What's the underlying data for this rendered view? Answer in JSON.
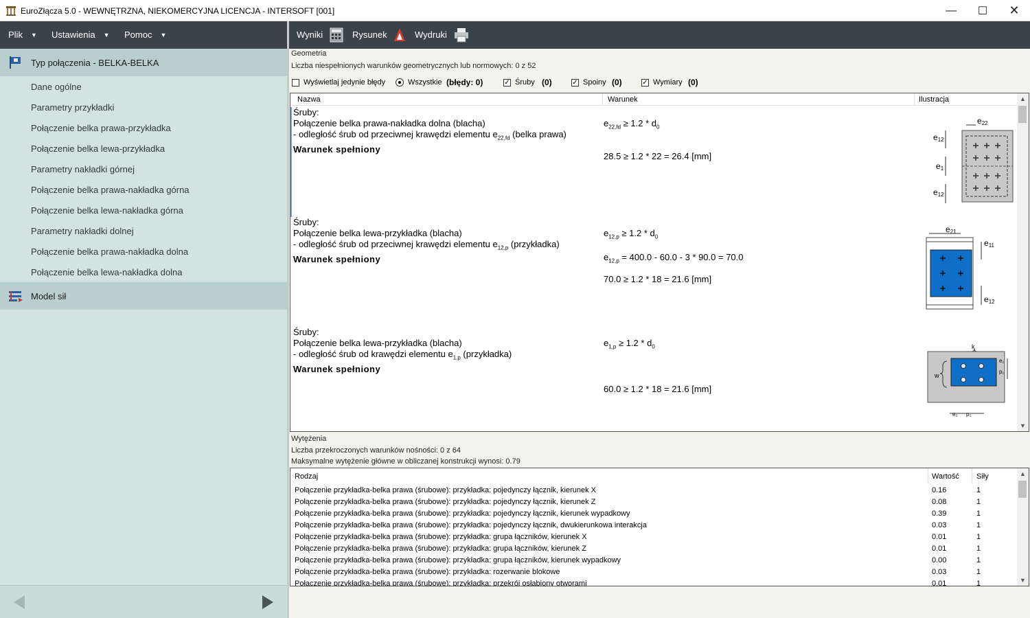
{
  "window": {
    "title": "EuroZłącza 5.0 - WEWNĘTRZNA, NIEKOMERCYJNA LICENCJA - INTERSOFT [001]"
  },
  "menu": {
    "items": [
      "Plik",
      "Ustawienia",
      "Pomoc"
    ]
  },
  "sidebar": {
    "section1": "Typ połączenia - BELKA-BELKA",
    "items": [
      "Dane ogólne",
      "Parametry przykładki",
      "Połączenie belka prawa-przykładka",
      "Połączenie belka lewa-przykładka",
      "Parametry nakładki górnej",
      "Połączenie belka prawa-nakładka górna",
      "Połączenie belka lewa-nakładka górna",
      "Parametry nakładki dolnej",
      "Połączenie belka prawa-nakładka dolna",
      "Połączenie belka lewa-nakładka dolna"
    ],
    "section2": "Model sił"
  },
  "toolbar": {
    "wyniki": "Wyniki",
    "rysunek": "Rysunek",
    "wydruki": "Wydruki"
  },
  "geometry": {
    "label": "Geometria",
    "count_text": "Liczba niespełnionych warunków geometrycznych lub normowych: 0 z 52",
    "filters": {
      "only_errors": "Wyświetlaj jedynie błędy",
      "all": "Wszystkie",
      "all_count": "(błędy: 0)",
      "bolts": "Śruby",
      "bolts_count": "(0)",
      "welds": "Spoiny",
      "welds_count": "(0)",
      "dims": "Wymiary",
      "dims_count": "(0)"
    },
    "columns": {
      "name": "Nazwa",
      "cond": "Warunek",
      "ill": "Ilustracja"
    },
    "rows": [
      {
        "l1": "Śruby:",
        "l2": "Połączenie belka prawa-nakładka dolna (blacha)",
        "l3a": "- odległość śrub od przeciwnej krawędzi elementu e",
        "l3sub": "22,fd",
        "l3b": " (belka prawa)",
        "l4": "Warunek spełniony",
        "c1a": "e",
        "c1sub": "22,fd",
        "c1b": " ≥ 1.2 * d",
        "c1sub2": "0",
        "c2": "28.5 ≥ 1.2 * 22 = 26.4 [mm]"
      },
      {
        "l1": "Śruby:",
        "l2": "Połączenie belka lewa-przykładka (blacha)",
        "l3a": "- odległość śrub od przeciwnej krawędzi elementu e",
        "l3sub": "12,p",
        "l3b": " (przykładka)",
        "l4": "Warunek spełniony",
        "c1a": "e",
        "c1sub": "12,p",
        "c1b": " ≥ 1.2 * d",
        "c1sub2": "0",
        "c2a": "e",
        "c2sub": "12,p",
        "c2b": " = 400.0 - 60.0 - 3 * 90.0 = 70.0",
        "c3": "70.0 ≥ 1.2 * 18 = 21.6 [mm]"
      },
      {
        "l1": "Śruby:",
        "l2": "Połączenie belka lewa-przykładka (blacha)",
        "l3a": "- odległość śrub od krawędzi elementu e",
        "l3sub": "1,p",
        "l3b": " (przykładka)",
        "l4": "Warunek spełniony",
        "c1a": "e",
        "c1sub": "1,p",
        "c1b": " ≥ 1.2 * d",
        "c1sub2": "0",
        "c2": "60.0 ≥ 1.2 * 18 = 21.6 [mm]"
      }
    ]
  },
  "utilization": {
    "label": "Wytężenia",
    "count_text": "Liczba przekroczonych warunków nośności: 0 z 64",
    "max_text": "Maksymalne wytężenie główne w obliczanej konstrukcji wynosi: 0.79",
    "columns": {
      "kind": "Rodzaj",
      "value": "Wartość",
      "forces": "Siły"
    },
    "rows": [
      {
        "kind": "Połączenie przykładka-belka prawa (śrubowe): przykładka: pojedynczy łącznik, kierunek X",
        "value": "0.16",
        "forces": "1"
      },
      {
        "kind": "Połączenie przykładka-belka prawa (śrubowe): przykładka: pojedynczy łącznik, kierunek Z",
        "value": "0.08",
        "forces": "1"
      },
      {
        "kind": "Połączenie przykładka-belka prawa (śrubowe): przykładka: pojedynczy łącznik, kierunek wypadkowy",
        "value": "0.39",
        "forces": "1"
      },
      {
        "kind": "Połączenie przykładka-belka prawa (śrubowe): przykładka: pojedynczy łącznik, dwukierunkowa interakcja",
        "value": "0.03",
        "forces": "1"
      },
      {
        "kind": "Połączenie przykładka-belka prawa (śrubowe): przykładka: grupa łączników, kierunek X",
        "value": "0.01",
        "forces": "1"
      },
      {
        "kind": "Połączenie przykładka-belka prawa (śrubowe): przykładka: grupa łączników, kierunek Z",
        "value": "0.01",
        "forces": "1"
      },
      {
        "kind": "Połączenie przykładka-belka prawa (śrubowe): przykładka: grupa łączników, kierunek wypadkowy",
        "value": "0.00",
        "forces": "1"
      },
      {
        "kind": "Połączenie przykładka-belka prawa (śrubowe): przykładka: rozerwanie blokowe",
        "value": "0.03",
        "forces": "1"
      },
      {
        "kind": "Połączenie przykładka-belka prawa (śrubowe): przykładka: przekrój osłabiony otworami",
        "value": "0.01",
        "forces": "1"
      }
    ]
  },
  "illustration_labels": {
    "e22": "e",
    "e22s": "22",
    "e12": "e",
    "e12s": "12",
    "e1": "e",
    "e1s": "1",
    "e21": "e",
    "e21s": "21",
    "e11": "e",
    "e11s": "11",
    "k": "k",
    "w": "w",
    "e1p": "e₁",
    "p1": "p₁",
    "e2p": "e₂",
    "p2": "p₂"
  },
  "colors": {
    "dark_bar": "#3a4448",
    "sidebar": "#d3e3e1",
    "sidebar_active": "#b9cfcd",
    "plate_blue": "#0f6fc6",
    "plate_gray": "#c8c8c8"
  }
}
